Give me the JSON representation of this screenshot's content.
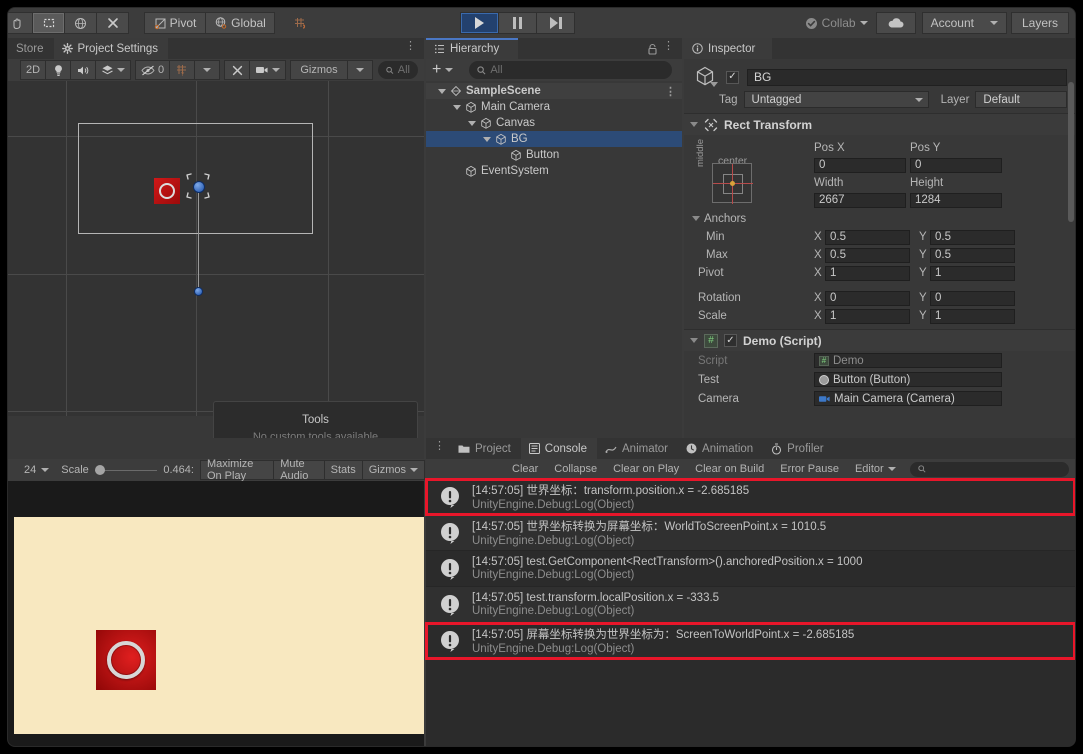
{
  "toolbar": {
    "tools": [
      {
        "name": "hand-tool",
        "glyph": "✥"
      },
      {
        "name": "rect-tool",
        "glyph": "⬚"
      },
      {
        "name": "move-tool",
        "glyph": "✛"
      },
      {
        "name": "rotate-tool",
        "glyph": "⟳"
      },
      {
        "name": "transform-tool",
        "glyph": "✕"
      }
    ],
    "pivot_label": "Pivot",
    "global_label": "Global",
    "collab_label": "Collab",
    "account_label": "Account",
    "layers_label": "Layers"
  },
  "scene": {
    "tabs": [
      {
        "label": "Store",
        "active": false
      },
      {
        "label": "Project Settings",
        "active": true,
        "icon": "gear-icon"
      }
    ],
    "toolbar": {
      "mode_2d": "2D",
      "light_icon": "light-bulb-icon",
      "audio_icon": "audio-icon",
      "fx_icon": "fx-icon",
      "hidden_count": "0",
      "grid_icon": "grid-icon",
      "gizmos_label": "Gizmos",
      "search_placeholder": "All"
    },
    "tools_popup": {
      "title": "Tools",
      "subtitle": "No custom tools available"
    }
  },
  "game": {
    "toolbar": {
      "resolution": "24",
      "scale_label": "Scale",
      "scale_value": "0.464:",
      "maximize_label": "Maximize On Play",
      "mute_label": "Mute Audio",
      "stats_label": "Stats",
      "gizmos_label": "Gizmos"
    },
    "background_color": "#f8e8c0",
    "button_color": "#d01818"
  },
  "hierarchy": {
    "tab_label": "Hierarchy",
    "lock_icon": "lock-icon",
    "menu_icon": "kebab-menu-icon",
    "add_label": "+",
    "search_placeholder": "All",
    "items": [
      {
        "label": "SampleScene",
        "depth": 0,
        "icon": "scene-icon",
        "expanded": true,
        "selected": false,
        "bold": true,
        "kebab": true
      },
      {
        "label": "Main Camera",
        "depth": 1,
        "icon": "gameobject-icon",
        "expanded": true,
        "selected": false
      },
      {
        "label": "Canvas",
        "depth": 2,
        "icon": "gameobject-icon",
        "expanded": true,
        "selected": false
      },
      {
        "label": "BG",
        "depth": 3,
        "icon": "gameobject-icon",
        "expanded": true,
        "selected": true
      },
      {
        "label": "Button",
        "depth": 4,
        "icon": "gameobject-icon",
        "expanded": false,
        "selected": false
      },
      {
        "label": "EventSystem",
        "depth": 1,
        "icon": "gameobject-icon",
        "expanded": false,
        "selected": false
      }
    ]
  },
  "inspector": {
    "tab_label": "Inspector",
    "object_name": "BG",
    "enabled": true,
    "tag_label": "Tag",
    "tag_value": "Untagged",
    "layer_label": "Layer",
    "layer_value": "Default",
    "rect_transform": {
      "title": "Rect Transform",
      "anchor_preset_top": "center",
      "anchor_preset_side": "middle",
      "fields": [
        {
          "label": "Pos X",
          "value": "0"
        },
        {
          "label": "Pos Y",
          "value": "0"
        },
        {
          "label": "Width",
          "value": "2667"
        },
        {
          "label": "Height",
          "value": "1284"
        }
      ],
      "anchors_label": "Anchors",
      "min_label": "Min",
      "min_x": "0.5",
      "min_y": "0.5",
      "max_label": "Max",
      "max_x": "0.5",
      "max_y": "0.5",
      "pivot_label": "Pivot",
      "pivot_x": "1",
      "pivot_y": "1",
      "rotation_label": "Rotation",
      "rotation_x": "0",
      "rotation_y": "0",
      "scale_label": "Scale",
      "scale_x": "1",
      "scale_y": "1",
      "axis_x": "X",
      "axis_y": "Y"
    },
    "demo_script": {
      "title": "Demo (Script)",
      "enabled": true,
      "rows": [
        {
          "label": "Script",
          "value": "Demo",
          "icon": "cs-script-icon",
          "disabled": true
        },
        {
          "label": "Test",
          "value": "Button (Button)",
          "icon": "button-component-icon",
          "disabled": false
        },
        {
          "label": "Camera",
          "value": "Main Camera (Camera)",
          "icon": "camera-icon",
          "disabled": false
        }
      ]
    }
  },
  "console": {
    "tabs": [
      {
        "label": "Project",
        "icon": "folder-icon",
        "active": false
      },
      {
        "label": "Console",
        "icon": "console-icon",
        "active": true
      },
      {
        "label": "Animator",
        "icon": "animator-icon",
        "active": false
      },
      {
        "label": "Animation",
        "icon": "animation-icon",
        "active": false
      },
      {
        "label": "Profiler",
        "icon": "profiler-icon",
        "active": false
      }
    ],
    "toolbar": {
      "clear": "Clear",
      "collapse": "Collapse",
      "clear_on_play": "Clear on Play",
      "clear_on_build": "Clear on Build",
      "error_pause": "Error Pause",
      "editor": "Editor",
      "search_placeholder": ""
    },
    "highlight_color": "#e8162a",
    "logs": [
      {
        "line1": "[14:57:05] 世界坐标：transform.position.x = -2.685185",
        "line2": "UnityEngine.Debug:Log(Object)",
        "icon": "info-icon",
        "highlighted": true
      },
      {
        "line1": "[14:57:05] 世界坐标转换为屏幕坐标：WorldToScreenPoint.x = 1010.5",
        "line2": "UnityEngine.Debug:Log(Object)",
        "icon": "info-icon",
        "highlighted": false
      },
      {
        "line1": "[14:57:05] test.GetComponent<RectTransform>().anchoredPosition.x = 1000",
        "line2": "UnityEngine.Debug:Log(Object)",
        "icon": "info-icon",
        "highlighted": false
      },
      {
        "line1": "[14:57:05] test.transform.localPosition.x = -333.5",
        "line2": "UnityEngine.Debug:Log(Object)",
        "icon": "info-icon",
        "highlighted": false
      },
      {
        "line1": "[14:57:05] 屏幕坐标转换为世界坐标为：ScreenToWorldPoint.x = -2.685185",
        "line2": "UnityEngine.Debug:Log(Object)",
        "icon": "info-icon",
        "highlighted": true
      }
    ]
  }
}
